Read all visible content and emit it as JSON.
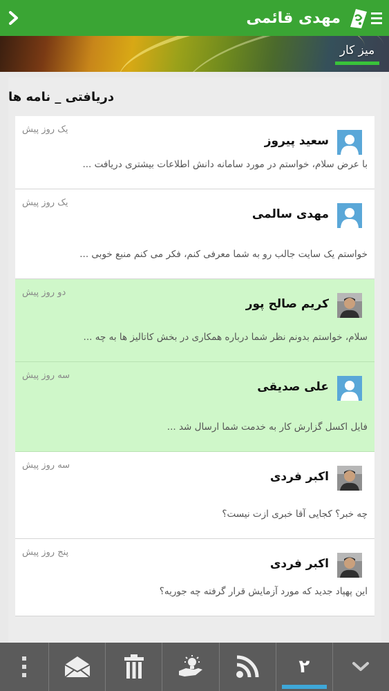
{
  "header": {
    "title": "مهدی قائمی",
    "logo_icon": "app-logo-icon",
    "back_icon": "chevron-right-icon",
    "menu_icon": "menu-icon"
  },
  "banner": {
    "tab_label": "میز کار"
  },
  "inbox": {
    "title": "دریافتی _ نامه ها",
    "messages": [
      {
        "sender": "سعید پیروز",
        "time": "یک روز پیش",
        "preview": "با عرض سلام، خواستم در مورد سامانه دانش اطلاعات بیشتری دریافت ...",
        "unread": false,
        "avatar": "default"
      },
      {
        "sender": "مهدی سالمی",
        "time": "یک روز پیش",
        "preview": "خواستم یک سایت جالب رو به شما معرفی کنم، فکر می کنم منبع خوبی ...",
        "unread": false,
        "avatar": "default"
      },
      {
        "sender": "کریم صالح پور",
        "time": "دو روز پیش",
        "preview": "سلام، خواستم بدونم نظر شما درباره همکاری در بخش کاتالیز ها به چه ...",
        "unread": true,
        "avatar": "photo"
      },
      {
        "sender": "علی صدیقی",
        "time": "سه روز پیش",
        "preview": "فایل اکسل گزارش کار به خدمت شما ارسال شد ...",
        "unread": true,
        "avatar": "default"
      },
      {
        "sender": "اکبر فردی",
        "time": "سه روز پیش",
        "preview": "چه خبر؟ کجایی آقا خبری ازت نیست؟",
        "unread": false,
        "avatar": "photo"
      },
      {
        "sender": "اکبر فردی",
        "time": "پنج روز پیش",
        "preview": "این پهپاد جدید که مورد آزمایش قرار گرفته چه جوریه؟",
        "unread": false,
        "avatar": "photo"
      }
    ]
  },
  "bottombar": {
    "items": [
      "more-icon",
      "envelope-open-icon",
      "trash-icon",
      "hand-bulb-icon",
      "rss-icon",
      "page-counter",
      "chevron-down-icon"
    ],
    "page_count": "۲"
  },
  "colors": {
    "header_green": "#3aa534",
    "unread_bg": "#cff7c9",
    "bottombar_bg": "#5b5b5b",
    "active_indicator": "#3ea7d8"
  }
}
